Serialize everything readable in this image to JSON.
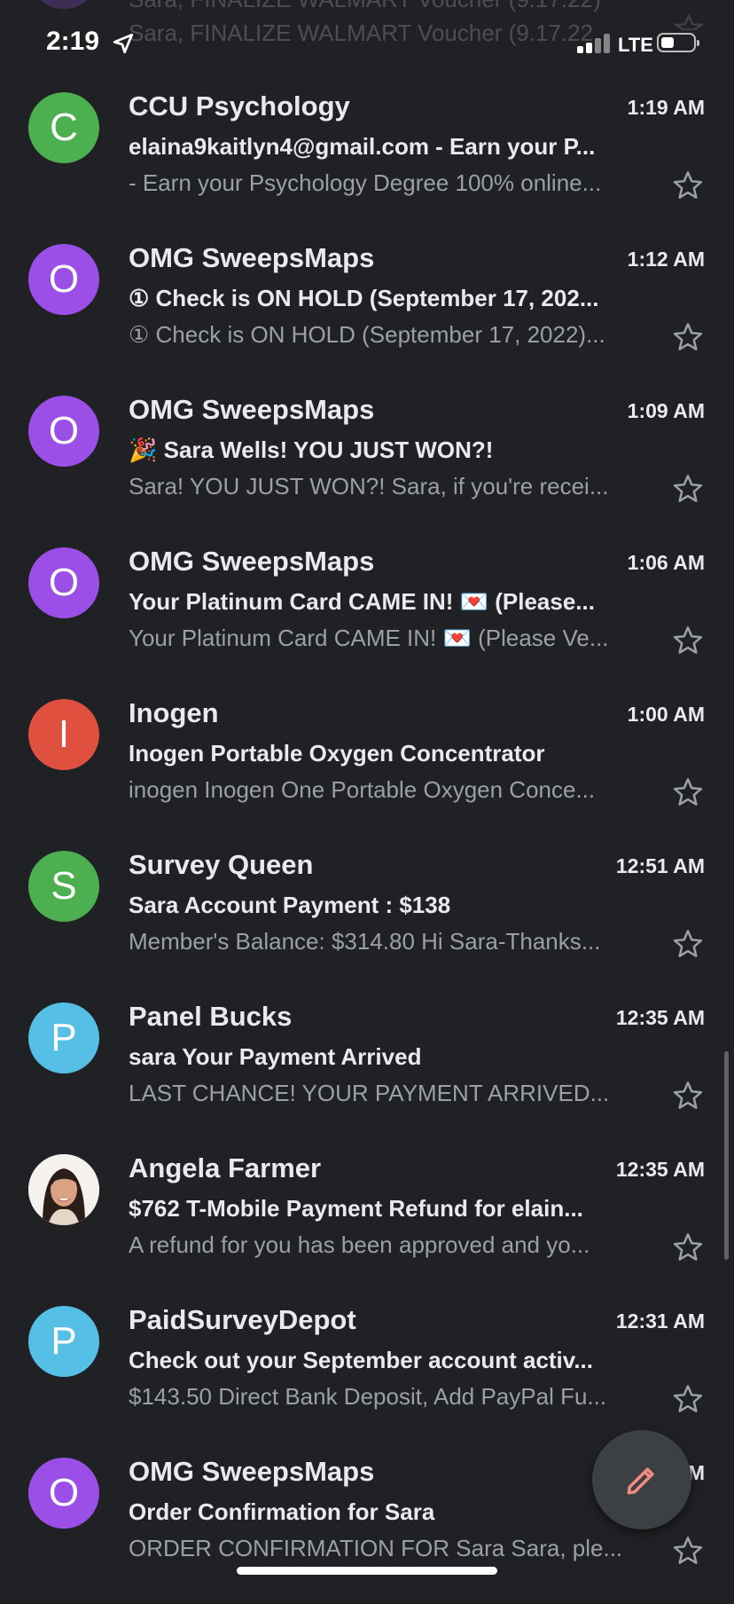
{
  "status_bar": {
    "time": "2:19",
    "network": "LTE",
    "prev_row_ghost": [
      "Sara, FINALIZE WALMART Voucher (9.17.22)",
      "Sara, FINALIZE WALMART Voucher (9.17.22"
    ]
  },
  "colors": {
    "background": "#202124",
    "accent": "#f28b82"
  },
  "emails": [
    {
      "avatar_letter": "C",
      "avatar_color": "#4caf50",
      "sender": "CCU Psychology",
      "time": "1:19 AM",
      "subject": "elaina9kaitlyn4@gmail.com - Earn your P...",
      "snippet": "- Earn your Psychology Degree 100% online..."
    },
    {
      "avatar_letter": "O",
      "avatar_color": "#9c4fe6",
      "sender": "OMG SweepsMaps",
      "time": "1:12 AM",
      "subject": "① Check is ON HOLD (September 17, 202...",
      "snippet": "① Check is ON HOLD (September 17, 2022)..."
    },
    {
      "avatar_letter": "O",
      "avatar_color": "#9c4fe6",
      "sender": "OMG SweepsMaps",
      "time": "1:09 AM",
      "subject": "🎉 Sara Wells! YOU JUST WON?!",
      "snippet": "Sara! YOU JUST WON?! Sara, if you're recei..."
    },
    {
      "avatar_letter": "O",
      "avatar_color": "#9c4fe6",
      "sender": "OMG SweepsMaps",
      "time": "1:06 AM",
      "subject": "Your Platinum Card CAME IN! 💌 (Please...",
      "snippet": "Your Platinum Card CAME IN! 💌 (Please Ve..."
    },
    {
      "avatar_letter": "I",
      "avatar_color": "#e0503e",
      "sender": "Inogen",
      "time": "1:00 AM",
      "subject": "Inogen Portable Oxygen Concentrator",
      "snippet": "inogen Inogen One Portable Oxygen Conce..."
    },
    {
      "avatar_letter": "S",
      "avatar_color": "#4caf50",
      "sender": "Survey Queen",
      "time": "12:51 AM",
      "subject": "Sara Account Payment : $138",
      "snippet": "Member's Balance: $314.80 Hi Sara-Thanks..."
    },
    {
      "avatar_letter": "P",
      "avatar_color": "#56bfe6",
      "sender": "Panel Bucks",
      "time": "12:35 AM",
      "subject": "sara Your Payment Arrived",
      "snippet": "LAST CHANCE! YOUR PAYMENT ARRIVED..."
    },
    {
      "avatar_letter": "",
      "avatar_color": "#f4f1ee",
      "avatar_photo": true,
      "sender": "Angela Farmer",
      "time": "12:35 AM",
      "subject": "$762 T-Mobile Payment Refund for elain...",
      "snippet": "A refund for you has been approved and yo..."
    },
    {
      "avatar_letter": "P",
      "avatar_color": "#56bfe6",
      "sender": "PaidSurveyDepot",
      "time": "12:31 AM",
      "subject": "Check out your September account activ...",
      "snippet": "$143.50 Direct Bank Deposit, Add PayPal Fu..."
    },
    {
      "avatar_letter": "O",
      "avatar_color": "#9c4fe6",
      "sender": "OMG SweepsMaps",
      "time": "M",
      "subject": "Order Confirmation for Sara",
      "snippet": "ORDER CONFIRMATION FOR Sara Sara, ple..."
    }
  ],
  "compose": {
    "icon": "pencil-icon"
  }
}
